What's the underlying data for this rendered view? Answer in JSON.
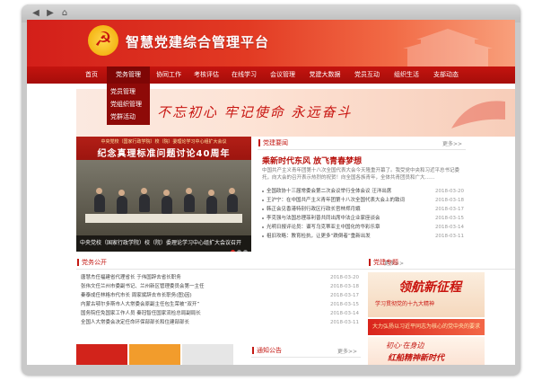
{
  "site": {
    "title": "智慧党建综合管理平台",
    "emblem_glyph": "☭"
  },
  "nav": {
    "items": [
      "首页",
      "党务管理",
      "协同工作",
      "考核评估",
      "在线学习",
      "会议管理",
      "党建大数据",
      "党员互动",
      "组织生活",
      "支部动态"
    ],
    "active_index": 1
  },
  "dropdown": {
    "items": [
      "党员管理",
      "党组织管理",
      "党群活动"
    ]
  },
  "slogan": {
    "text": "不忘初心  牢记使命  永远奋斗"
  },
  "photo": {
    "banner_small": "中央党校（国家行政学院）校（院）委理论学习中心组扩大会议",
    "banner_big": "纪念真理标准问题讨论40周年",
    "caption": "中央党校（国家行政学院）校（院）委理论学习中心组扩大会议召开"
  },
  "news": {
    "title": "党建要闻",
    "more": "更多>>",
    "headline": "乘新时代东风 放飞青春梦想",
    "summary": "中国共产主义青年团第十八次全国代表大会今天隆重开幕了。我受党中央和习近平总书记委托，向大会的召开表示热烈的祝贺！向全国各族青年，全体共青团员和广大……",
    "items": [
      {
        "text": "全国政协十三届常委会第二次会议举行全体会议 汪洋出席",
        "date": "2018-03-20"
      },
      {
        "text": "王沪宁：在中国共产主义青年团第十八次全国代表大会上的致词",
        "date": "2018-03-18"
      },
      {
        "text": "韩正会见香港特别行政区行政长官林郑月娥",
        "date": "2018-03-17"
      },
      {
        "text": "李克强与法国总理菲利普共同出席中法企业家座谈会",
        "date": "2018-03-15"
      },
      {
        "text": "光明日报评论员：谱写乌克蒂亚主中国化的华彩乐章",
        "date": "2018-03-14"
      },
      {
        "text": "祖旧攻略：教育检执，让更多“跌倒者”重新出发",
        "date": "2018-03-11"
      }
    ]
  },
  "publicity": {
    "title": "党务公开",
    "more": "更多>>",
    "items": [
      {
        "text": "唐慧杰任福建省代理省长 于伟国辞去省长职务",
        "date": "2018-03-20"
      },
      {
        "text": "张伟文任兰州市委副书记、兰州新区管理委员会第一主任",
        "date": "2018-03-18"
      },
      {
        "text": "秦泰成任林格市代市长 周家斌辞去市长职务(图)因)",
        "date": "2018-03-17"
      },
      {
        "text": "内蒙古鄂尔多斯市人大常委会原副主任包生荣被“双开”",
        "date": "2018-03-15"
      },
      {
        "text": "国务院任免国家工作人员 秦冠智任国家流检总局副局长",
        "date": "2018-03-14"
      },
      {
        "text": "全国人大常委会决定任命环保部部长和住建部部长",
        "date": "2018-03-11"
      }
    ]
  },
  "special": {
    "title": "党建专题",
    "banner1_title": "领航新征程",
    "banner1_sub": "学习贯彻党的十九大精神",
    "banner2": "大力弘扬以习近平同志为核心的党中央的要求",
    "banner3_a": "初心·在身边",
    "banner3_b": "红船精神新时代"
  },
  "notice": {
    "title": "通知公告",
    "more": "更多>>"
  },
  "colors": {
    "primary": "#c41a14",
    "nav": "#b5110c"
  }
}
